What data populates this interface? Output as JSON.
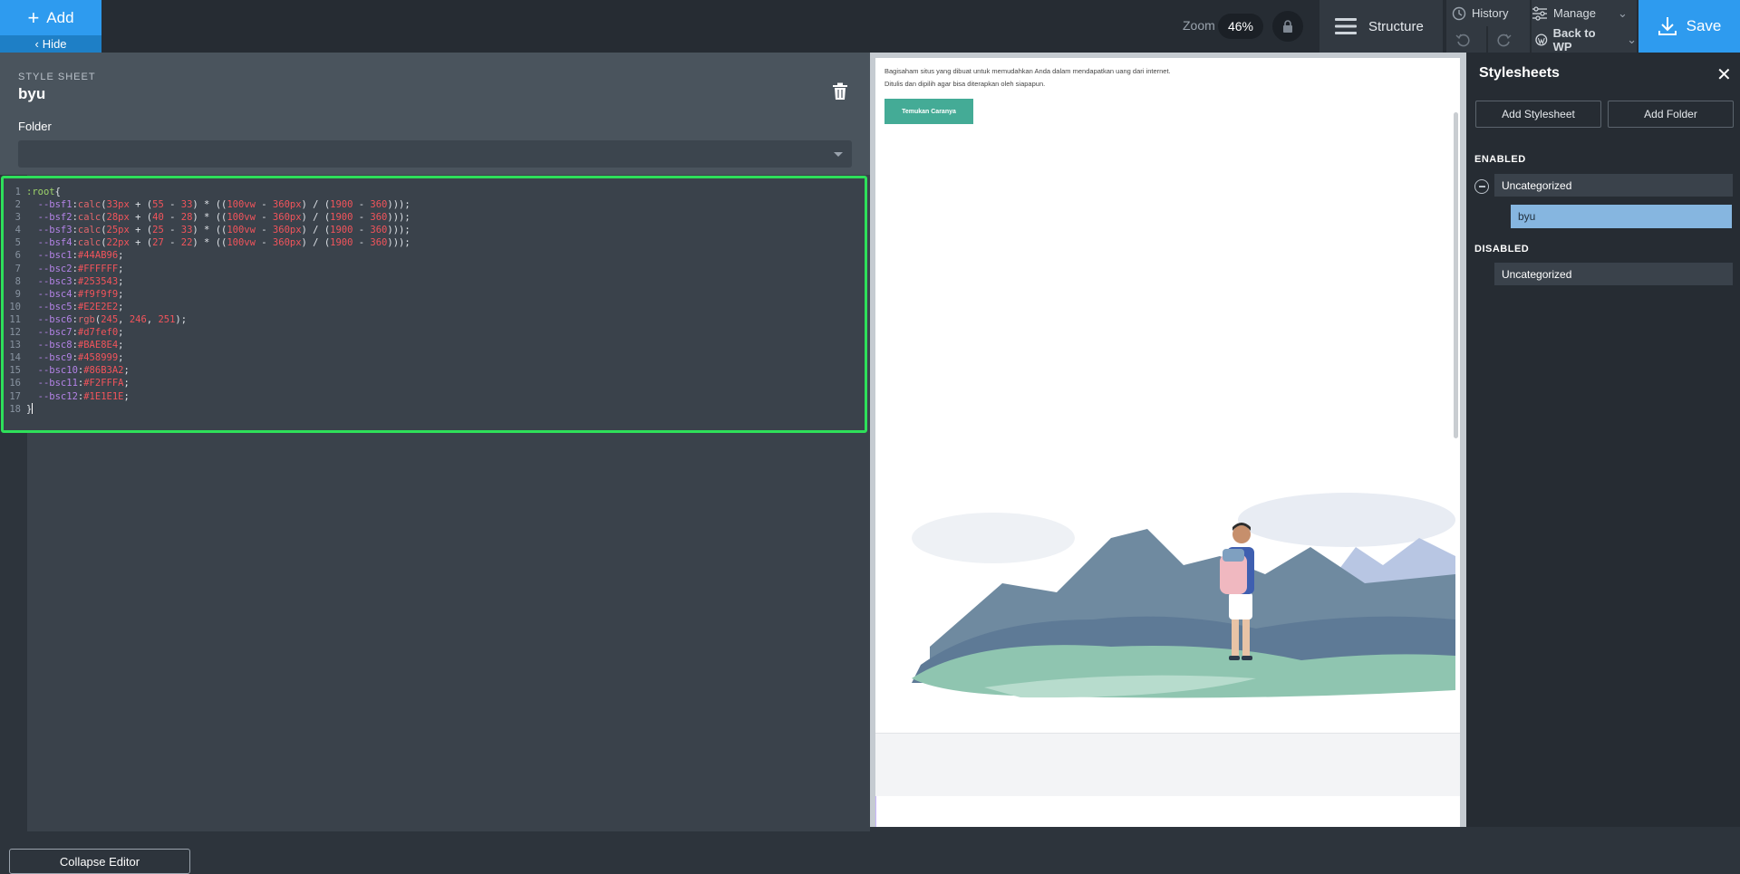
{
  "topbar": {
    "add_label": "Add",
    "hide_label": "Hide",
    "zoom_label": "Zoom",
    "zoom_value": "46%",
    "structure_label": "Structure",
    "history_label": "History",
    "manage_label": "Manage",
    "back_label": "Back to WP",
    "save_label": "Save"
  },
  "editor": {
    "section_label": "STYLE SHEET",
    "stylesheet_name": "byu",
    "folder_label": "Folder",
    "folder_value": "",
    "collapse_label": "Collapse Editor",
    "code_lines": [
      [
        {
          "t": ":root",
          "c": "c-sel"
        },
        {
          "t": "{",
          "c": "c-op"
        }
      ],
      [
        {
          "t": "  --bsf1",
          "c": "c-var"
        },
        {
          "t": ":",
          "c": "c-op"
        },
        {
          "t": "calc",
          "c": "c-fn"
        },
        {
          "t": "(",
          "c": "c-op"
        },
        {
          "t": "33px",
          "c": "c-num"
        },
        {
          "t": " + (",
          "c": "c-op"
        },
        {
          "t": "55",
          "c": "c-num"
        },
        {
          "t": " - ",
          "c": "c-op"
        },
        {
          "t": "33",
          "c": "c-num"
        },
        {
          "t": ") * ((",
          "c": "c-op"
        },
        {
          "t": "100vw",
          "c": "c-num"
        },
        {
          "t": " - ",
          "c": "c-op"
        },
        {
          "t": "360px",
          "c": "c-num"
        },
        {
          "t": ") / (",
          "c": "c-op"
        },
        {
          "t": "1900",
          "c": "c-num"
        },
        {
          "t": " - ",
          "c": "c-op"
        },
        {
          "t": "360",
          "c": "c-num"
        },
        {
          "t": ")));",
          "c": "c-op"
        }
      ],
      [
        {
          "t": "  --bsf2",
          "c": "c-var"
        },
        {
          "t": ":",
          "c": "c-op"
        },
        {
          "t": "calc",
          "c": "c-fn"
        },
        {
          "t": "(",
          "c": "c-op"
        },
        {
          "t": "28px",
          "c": "c-num"
        },
        {
          "t": " + (",
          "c": "c-op"
        },
        {
          "t": "40",
          "c": "c-num"
        },
        {
          "t": " - ",
          "c": "c-op"
        },
        {
          "t": "28",
          "c": "c-num"
        },
        {
          "t": ") * ((",
          "c": "c-op"
        },
        {
          "t": "100vw",
          "c": "c-num"
        },
        {
          "t": " - ",
          "c": "c-op"
        },
        {
          "t": "360px",
          "c": "c-num"
        },
        {
          "t": ") / (",
          "c": "c-op"
        },
        {
          "t": "1900",
          "c": "c-num"
        },
        {
          "t": " - ",
          "c": "c-op"
        },
        {
          "t": "360",
          "c": "c-num"
        },
        {
          "t": ")));",
          "c": "c-op"
        }
      ],
      [
        {
          "t": "  --bsf3",
          "c": "c-var"
        },
        {
          "t": ":",
          "c": "c-op"
        },
        {
          "t": "calc",
          "c": "c-fn"
        },
        {
          "t": "(",
          "c": "c-op"
        },
        {
          "t": "25px",
          "c": "c-num"
        },
        {
          "t": " + (",
          "c": "c-op"
        },
        {
          "t": "25",
          "c": "c-num"
        },
        {
          "t": " - ",
          "c": "c-op"
        },
        {
          "t": "33",
          "c": "c-num"
        },
        {
          "t": ") * ((",
          "c": "c-op"
        },
        {
          "t": "100vw",
          "c": "c-num"
        },
        {
          "t": " - ",
          "c": "c-op"
        },
        {
          "t": "360px",
          "c": "c-num"
        },
        {
          "t": ") / (",
          "c": "c-op"
        },
        {
          "t": "1900",
          "c": "c-num"
        },
        {
          "t": " - ",
          "c": "c-op"
        },
        {
          "t": "360",
          "c": "c-num"
        },
        {
          "t": ")));",
          "c": "c-op"
        }
      ],
      [
        {
          "t": "  --bsf4",
          "c": "c-var"
        },
        {
          "t": ":",
          "c": "c-op"
        },
        {
          "t": "calc",
          "c": "c-fn"
        },
        {
          "t": "(",
          "c": "c-op"
        },
        {
          "t": "22px",
          "c": "c-num"
        },
        {
          "t": " + (",
          "c": "c-op"
        },
        {
          "t": "27",
          "c": "c-num"
        },
        {
          "t": " - ",
          "c": "c-op"
        },
        {
          "t": "22",
          "c": "c-num"
        },
        {
          "t": ") * ((",
          "c": "c-op"
        },
        {
          "t": "100vw",
          "c": "c-num"
        },
        {
          "t": " - ",
          "c": "c-op"
        },
        {
          "t": "360px",
          "c": "c-num"
        },
        {
          "t": ") / (",
          "c": "c-op"
        },
        {
          "t": "1900",
          "c": "c-num"
        },
        {
          "t": " - ",
          "c": "c-op"
        },
        {
          "t": "360",
          "c": "c-num"
        },
        {
          "t": ")));",
          "c": "c-op"
        }
      ],
      [
        {
          "t": "  --bsc1",
          "c": "c-var"
        },
        {
          "t": ":",
          "c": "c-op"
        },
        {
          "t": "#44AB96",
          "c": "c-num"
        },
        {
          "t": ";",
          "c": "c-op"
        }
      ],
      [
        {
          "t": "  --bsc2",
          "c": "c-var"
        },
        {
          "t": ":",
          "c": "c-op"
        },
        {
          "t": "#FFFFFF",
          "c": "c-num"
        },
        {
          "t": ";",
          "c": "c-op"
        }
      ],
      [
        {
          "t": "  --bsc3",
          "c": "c-var"
        },
        {
          "t": ":",
          "c": "c-op"
        },
        {
          "t": "#253543",
          "c": "c-num"
        },
        {
          "t": ";",
          "c": "c-op"
        }
      ],
      [
        {
          "t": "  --bsc4",
          "c": "c-var"
        },
        {
          "t": ":",
          "c": "c-op"
        },
        {
          "t": "#f9f9f9",
          "c": "c-num"
        },
        {
          "t": ";",
          "c": "c-op"
        }
      ],
      [
        {
          "t": "  --bsc5",
          "c": "c-var"
        },
        {
          "t": ":",
          "c": "c-op"
        },
        {
          "t": "#E2E2E2",
          "c": "c-num"
        },
        {
          "t": ";",
          "c": "c-op"
        }
      ],
      [
        {
          "t": "  --bsc6",
          "c": "c-var"
        },
        {
          "t": ":",
          "c": "c-op"
        },
        {
          "t": "rgb",
          "c": "c-fn"
        },
        {
          "t": "(",
          "c": "c-op"
        },
        {
          "t": "245",
          "c": "c-num"
        },
        {
          "t": ", ",
          "c": "c-op"
        },
        {
          "t": "246",
          "c": "c-num"
        },
        {
          "t": ", ",
          "c": "c-op"
        },
        {
          "t": "251",
          "c": "c-num"
        },
        {
          "t": ");",
          "c": "c-op"
        }
      ],
      [
        {
          "t": "  --bsc7",
          "c": "c-var"
        },
        {
          "t": ":",
          "c": "c-op"
        },
        {
          "t": "#d7fef0",
          "c": "c-num"
        },
        {
          "t": ";",
          "c": "c-op"
        }
      ],
      [
        {
          "t": "  --bsc8",
          "c": "c-var"
        },
        {
          "t": ":",
          "c": "c-op"
        },
        {
          "t": "#BAE8E4",
          "c": "c-num"
        },
        {
          "t": ";",
          "c": "c-op"
        }
      ],
      [
        {
          "t": "  --bsc9",
          "c": "c-var"
        },
        {
          "t": ":",
          "c": "c-op"
        },
        {
          "t": "#458999",
          "c": "c-num"
        },
        {
          "t": ";",
          "c": "c-op"
        }
      ],
      [
        {
          "t": "  --bsc10",
          "c": "c-var"
        },
        {
          "t": ":",
          "c": "c-op"
        },
        {
          "t": "#86B3A2",
          "c": "c-num"
        },
        {
          "t": ";",
          "c": "c-op"
        }
      ],
      [
        {
          "t": "  --bsc11",
          "c": "c-var"
        },
        {
          "t": ":",
          "c": "c-op"
        },
        {
          "t": "#F2FFFA",
          "c": "c-num"
        },
        {
          "t": ";",
          "c": "c-op"
        }
      ],
      [
        {
          "t": "  --bsc12",
          "c": "c-var"
        },
        {
          "t": ":",
          "c": "c-op"
        },
        {
          "t": "#1E1E1E",
          "c": "c-num"
        },
        {
          "t": ";",
          "c": "c-op"
        }
      ],
      [
        {
          "t": "}",
          "c": "c-op"
        },
        {
          "t": "",
          "c": "cursor"
        }
      ]
    ]
  },
  "preview": {
    "text": "Bagisaham situs yang dibuat untuk memudahkan Anda dalam mendapatkan uang dari internet. Ditulis dan dipilih agar bisa diterapkan oleh siapapun.",
    "button_label": "Temukan Caranya",
    "button_color": "#44AB96"
  },
  "sidebar": {
    "title": "Stylesheets",
    "add_stylesheet_label": "Add Stylesheet",
    "add_folder_label": "Add Folder",
    "enabled_label": "ENABLED",
    "enabled_folder": "Uncategorized",
    "enabled_sheet": "byu",
    "disabled_label": "DISABLED",
    "disabled_folder": "Uncategorized"
  },
  "colors": {
    "accent": "#2E9BEF",
    "highlight_border": "#2EE05A",
    "selected_sheet": "#86B6E0"
  }
}
